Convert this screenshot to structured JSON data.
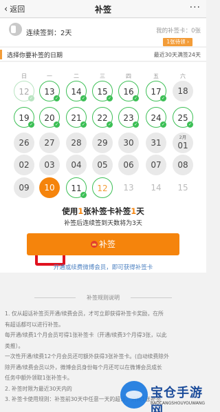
{
  "nav": {
    "back_label": "返回",
    "title": "补签",
    "more": "···"
  },
  "status": {
    "streak": "连续签到：2天",
    "cards": "我的补签卡：0张",
    "pending": "1张待领 ›"
  },
  "picker": {
    "label": "选择你要补签的日期",
    "note": "最近30天满签24天"
  },
  "calendar": {
    "weekdays": [
      "日",
      "一",
      "二",
      "三",
      "四",
      "五",
      "六"
    ],
    "rows": [
      [
        {
          "d": "12",
          "s": "faded"
        },
        {
          "d": "13",
          "s": "signed"
        },
        {
          "d": "14",
          "s": "signed"
        },
        {
          "d": "15",
          "s": "signed"
        },
        {
          "d": "16",
          "s": "signed"
        },
        {
          "d": "17",
          "s": "signed"
        },
        {
          "d": "18",
          "s": "missed"
        }
      ],
      [
        {
          "d": "19",
          "s": "signed"
        },
        {
          "d": "20",
          "s": "signed"
        },
        {
          "d": "21",
          "s": "signed"
        },
        {
          "d": "22",
          "s": "signed"
        },
        {
          "d": "23",
          "s": "signed"
        },
        {
          "d": "24",
          "s": "signed"
        },
        {
          "d": "25",
          "s": "signed"
        }
      ],
      [
        {
          "d": "26",
          "s": "missed"
        },
        {
          "d": "27",
          "s": "missed"
        },
        {
          "d": "28",
          "s": "missed"
        },
        {
          "d": "29",
          "s": "missed"
        },
        {
          "d": "30",
          "s": "missed"
        },
        {
          "d": "31",
          "s": "missed"
        },
        {
          "d": "01",
          "s": "missed",
          "m": "2月"
        }
      ],
      [
        {
          "d": "02",
          "s": "missed"
        },
        {
          "d": "03",
          "s": "missed"
        },
        {
          "d": "04",
          "s": "missed"
        },
        {
          "d": "05",
          "s": "missed"
        },
        {
          "d": "06",
          "s": "missed"
        },
        {
          "d": "07",
          "s": "missed"
        },
        {
          "d": "08",
          "s": "missed"
        }
      ],
      [
        {
          "d": "09",
          "s": "missed"
        },
        {
          "d": "10",
          "s": "selected"
        },
        {
          "d": "11",
          "s": "signed"
        },
        {
          "d": "12",
          "s": "today"
        },
        {
          "d": "13",
          "s": "future"
        },
        {
          "d": "14",
          "s": "future"
        },
        {
          "d": "15",
          "s": "future"
        }
      ]
    ]
  },
  "use": {
    "pre": "使用",
    "count": "1",
    "mid": "张补签卡补签",
    "days": "1",
    "post": "天"
  },
  "after_text": "补签后连续签到天数将为3天",
  "button": {
    "label": "补签"
  },
  "vip_link": "开通或续费微博会员，即可获得补签卡",
  "rules": {
    "title": "补签规则说明",
    "lines": [
      "1. 仅从超话补签页开通/续费会员，才可立即获得补签卡奖励，在所",
      "有超话都可以进行补签。",
      "每开通/续费1个月会员可得1张补签卡（开通/续费3个月得3张，以此",
      "类推）。",
      "一次性开通/续费12个月会员还可额外获得3张补签卡。(自动续费除外",
      "除开通/续费会员以外，微博会员身份每个月还可以在微博会员成长",
      "任务中额外领取1张补签卡。",
      "2. 补签时限为最近30天内的",
      "3. 补签卡使用规则：补签前30天中任意一天的超话，消耗1张补签"
    ]
  },
  "watermark": {
    "name": "宝仓手游网",
    "url": "BAOCANGSHOUYOUWANG"
  },
  "colors": {
    "accent": "#f5840c",
    "signed": "#3cbf55",
    "link": "#4a7fc0",
    "highlight_frame": "#e0121f"
  }
}
